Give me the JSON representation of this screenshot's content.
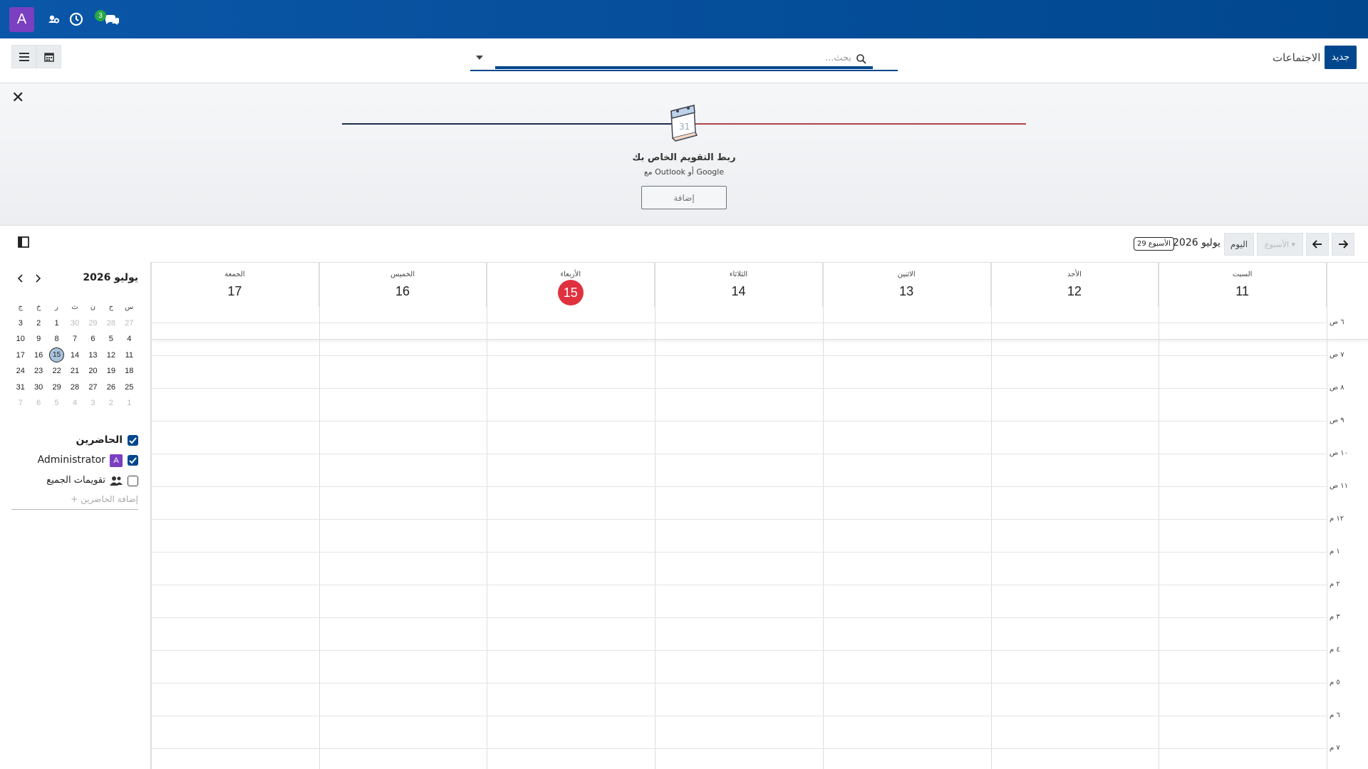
{
  "topbar": {
    "avatar_letter": "A",
    "badge_count": "3",
    "icons": [
      "people-settings-icon",
      "clock-icon",
      "chat-bubbles-icon"
    ]
  },
  "control_panel": {
    "new_button": "جديد",
    "title": "الاجتماعات",
    "search_placeholder": "بحث..."
  },
  "promo": {
    "calendar_icon_day": "31",
    "title": "ربط التقويم الخاص بك",
    "subtitle": "مع Outlook أو Google",
    "button": "إضافة"
  },
  "toolbar": {
    "week_button": "الأسبوع ▾",
    "today_button": "اليوم",
    "title": "يوليو 2026",
    "week_badge": "الأسبوع 29"
  },
  "mini_calendar": {
    "title": "يوليو 2026",
    "weekday_headers": [
      "س",
      "ح",
      "ن",
      "ث",
      "ر",
      "خ",
      "ج"
    ],
    "weeks": [
      [
        {
          "d": "27",
          "o": true
        },
        {
          "d": "28",
          "o": true
        },
        {
          "d": "29",
          "o": true
        },
        {
          "d": "30",
          "o": true
        },
        {
          "d": "1"
        },
        {
          "d": "2"
        },
        {
          "d": "3"
        }
      ],
      [
        {
          "d": "4"
        },
        {
          "d": "5"
        },
        {
          "d": "6"
        },
        {
          "d": "7"
        },
        {
          "d": "8"
        },
        {
          "d": "9"
        },
        {
          "d": "10"
        }
      ],
      [
        {
          "d": "11"
        },
        {
          "d": "12"
        },
        {
          "d": "13"
        },
        {
          "d": "14"
        },
        {
          "d": "15",
          "t": true
        },
        {
          "d": "16"
        },
        {
          "d": "17"
        }
      ],
      [
        {
          "d": "18"
        },
        {
          "d": "19"
        },
        {
          "d": "20"
        },
        {
          "d": "21"
        },
        {
          "d": "22"
        },
        {
          "d": "23"
        },
        {
          "d": "24"
        }
      ],
      [
        {
          "d": "25"
        },
        {
          "d": "26"
        },
        {
          "d": "27"
        },
        {
          "d": "28"
        },
        {
          "d": "29"
        },
        {
          "d": "30"
        },
        {
          "d": "31"
        }
      ],
      [
        {
          "d": "1",
          "o": true
        },
        {
          "d": "2",
          "o": true
        },
        {
          "d": "3",
          "o": true
        },
        {
          "d": "4",
          "o": true
        },
        {
          "d": "5",
          "o": true
        },
        {
          "d": "6",
          "o": true
        },
        {
          "d": "7",
          "o": true
        }
      ]
    ]
  },
  "attendees": {
    "header": "الحاضرين",
    "admin": "Administrator",
    "admin_letter": "A",
    "everybody": "تقويمات الجميع",
    "add": "+ إضافة الحاضرين"
  },
  "week": {
    "days": [
      {
        "name": "السبت",
        "num": "11"
      },
      {
        "name": "الأحد",
        "num": "12"
      },
      {
        "name": "الاثنين",
        "num": "13"
      },
      {
        "name": "الثلاثاء",
        "num": "14"
      },
      {
        "name": "الأربعاء",
        "num": "15",
        "today": true
      },
      {
        "name": "الخميس",
        "num": "16"
      },
      {
        "name": "الجمعة",
        "num": "17"
      }
    ],
    "hour_labels": [
      "٦ ص",
      "٧ ص",
      "٨ ص",
      "٩ ص",
      "١٠ ص",
      "١١ ص",
      "١٢ م",
      "١ م",
      "٢ م",
      "٣ م",
      "٤ م",
      "٥ م",
      "٦ م",
      "٧ م"
    ]
  },
  "colors": {
    "brand": "#00478e",
    "avatar": "#7b3fc1",
    "today": "#e0313f",
    "badge": "#28a745"
  }
}
